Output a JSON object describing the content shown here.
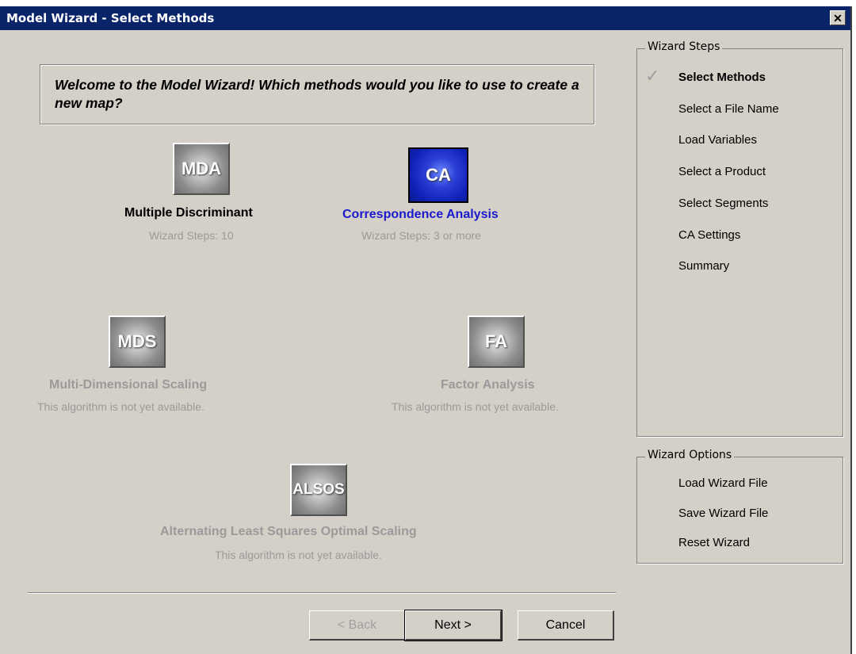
{
  "window": {
    "title": "Model Wizard - Select Methods",
    "close_glyph": "✕"
  },
  "welcome": {
    "text": "Welcome to the Model Wizard!  Which methods would you like to use to create a new map?"
  },
  "methods": {
    "mda": {
      "icon_text": "MDA",
      "name": "Multiple Discriminant",
      "sub": "Wizard Steps: 10",
      "name_color": "#000000"
    },
    "ca": {
      "icon_text": "CA",
      "name": "Correspondence Analysis",
      "sub": "Wizard Steps: 3 or more",
      "name_color": "#1a1acc"
    },
    "mds": {
      "icon_text": "MDS",
      "name": "Multi-Dimensional Scaling",
      "sub": "This algorithm is not yet available.",
      "name_color": "#9a9a9a"
    },
    "fa": {
      "icon_text": "FA",
      "name": "Factor Analysis",
      "sub": "This algorithm is not yet available.",
      "name_color": "#9a9a9a"
    },
    "alsos": {
      "icon_text": "ALSOS",
      "name": "Alternating Least Squares Optimal Scaling",
      "sub": "This algorithm is not yet available.",
      "name_color": "#9a9a9a"
    }
  },
  "wizard_steps": {
    "legend": "Wizard Steps",
    "check_glyph": "✓",
    "items": [
      "Select Methods",
      "Select a File Name",
      "Load Variables",
      "Select a Product",
      "Select Segments",
      "CA Settings",
      "Summary"
    ]
  },
  "wizard_options": {
    "legend": "Wizard Options",
    "items": [
      "Load Wizard File",
      "Save Wizard File",
      "Reset Wizard"
    ]
  },
  "buttons": {
    "back": "< Back",
    "next": "Next >",
    "cancel": "Cancel"
  }
}
